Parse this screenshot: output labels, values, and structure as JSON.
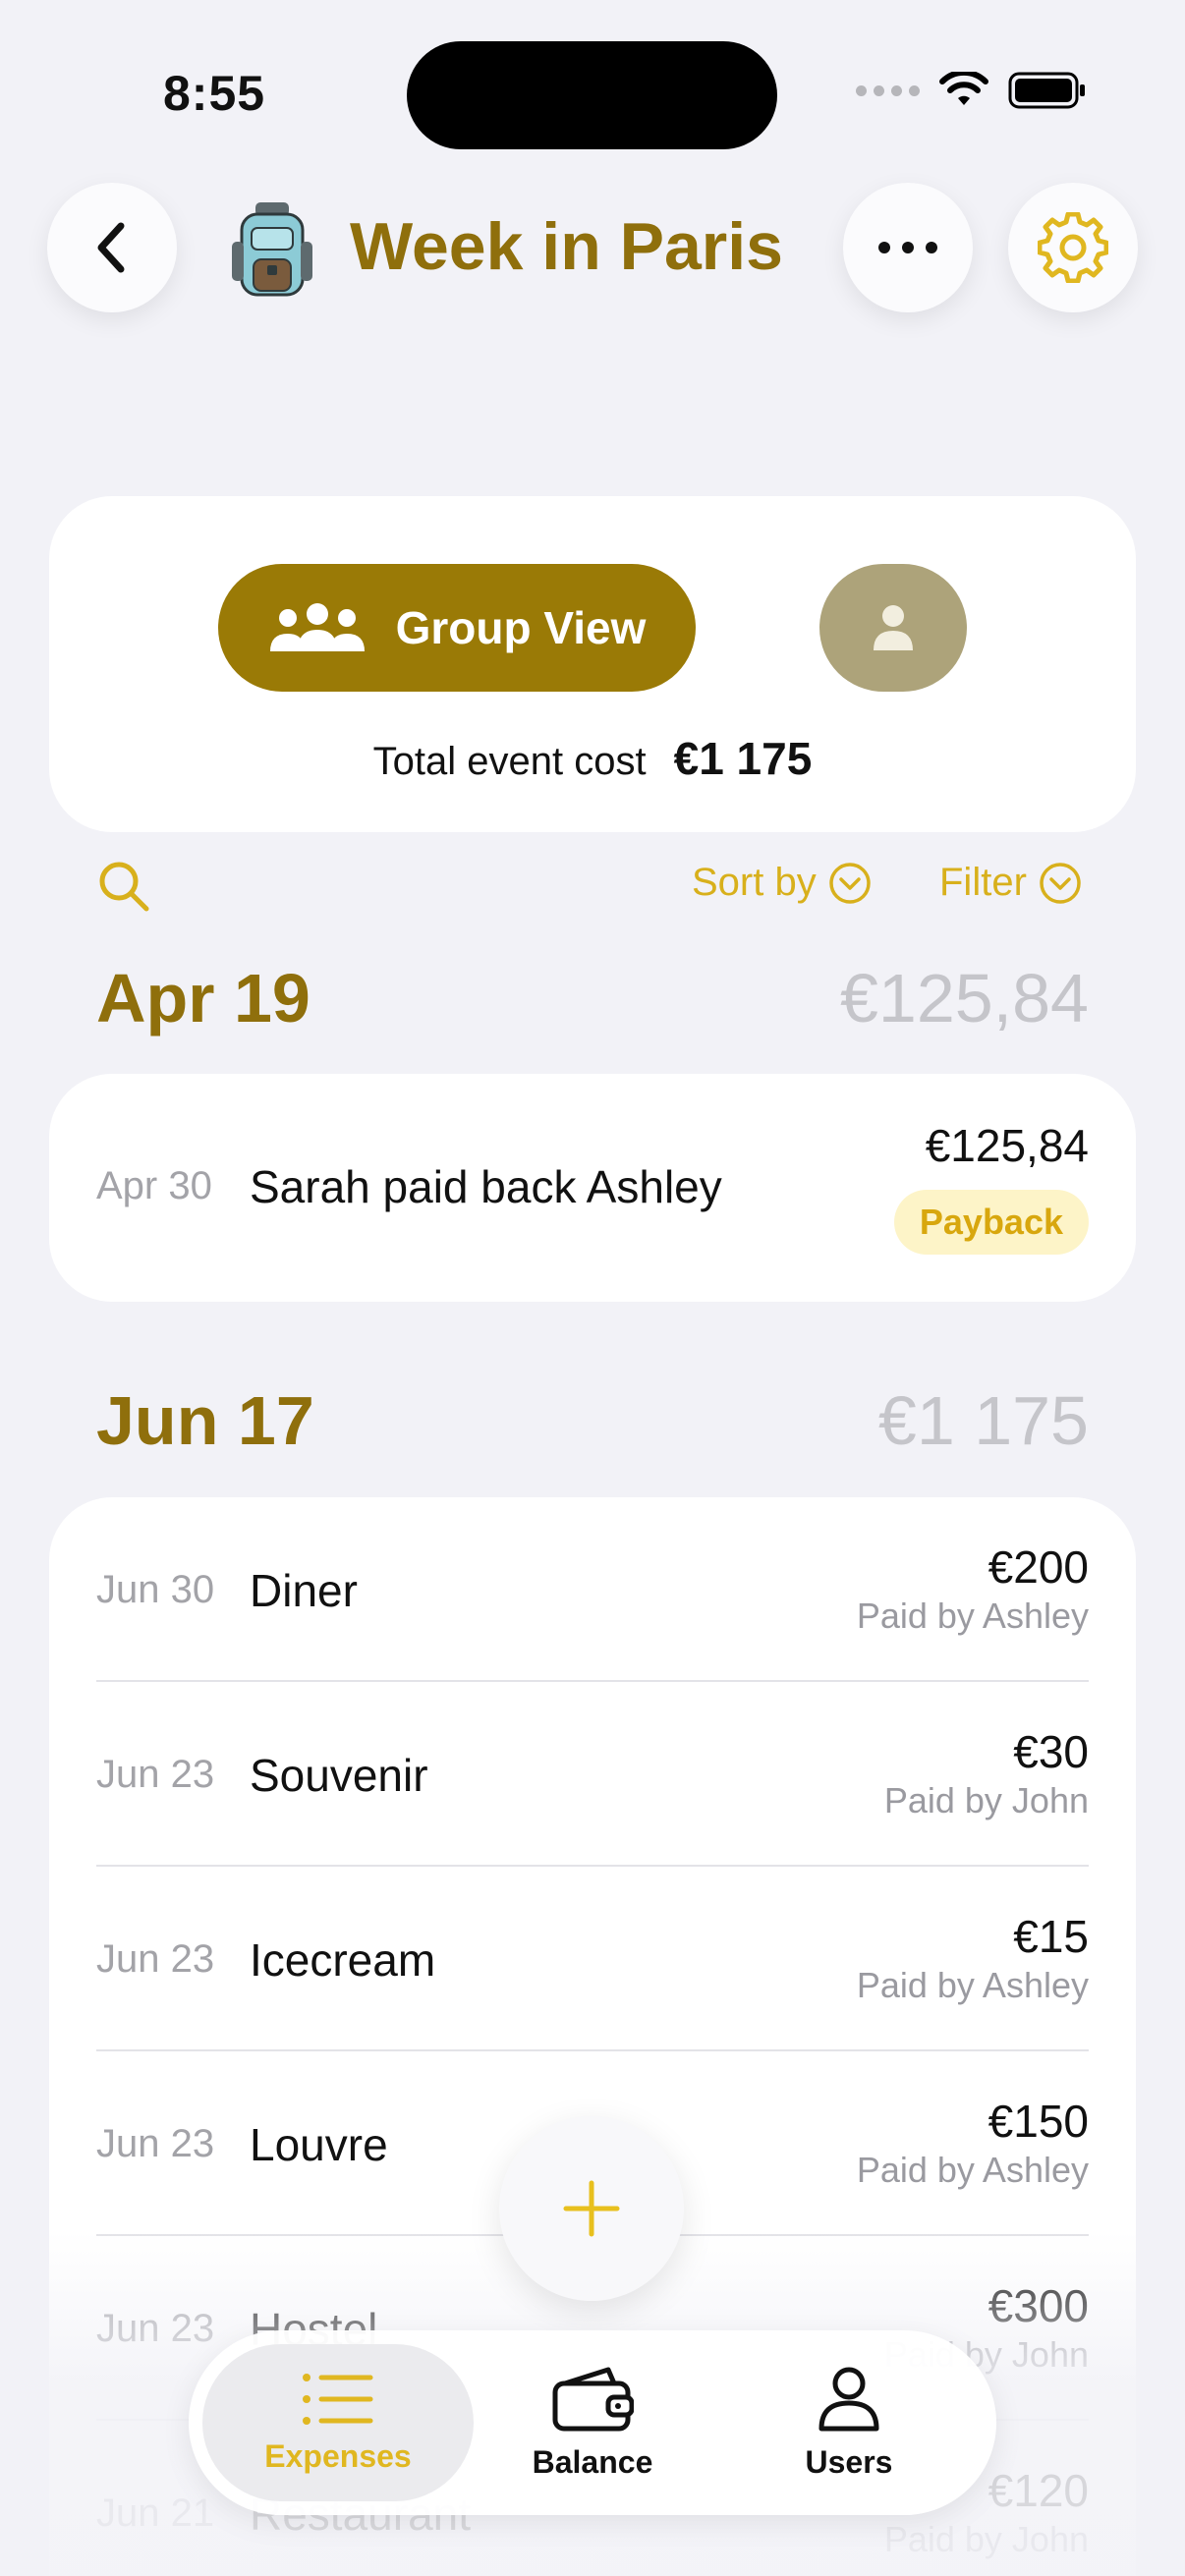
{
  "status_bar": {
    "time": "8:55"
  },
  "header": {
    "title": "Week in Paris",
    "icon": "backpack-icon",
    "back_icon": "chevron-left-icon",
    "more_icon": "ellipsis-icon",
    "settings_icon": "gear-icon"
  },
  "view_switch": {
    "group_label": "Group View",
    "total_label": "Total event cost",
    "total_value": "€1 175"
  },
  "toolbar": {
    "sort_label": "Sort by",
    "filter_label": "Filter"
  },
  "sections": [
    {
      "date": "Apr 19",
      "total": "€125,84",
      "rows": [
        {
          "date": "Apr 30",
          "title": "Sarah paid back Ashley",
          "amount": "€125,84",
          "badge": "Payback"
        }
      ]
    },
    {
      "date": "Jun 17",
      "total": "€1 175",
      "rows": [
        {
          "date": "Jun 30",
          "title": "Diner",
          "amount": "€200",
          "paid_by": "Paid by Ashley"
        },
        {
          "date": "Jun 23",
          "title": "Souvenir",
          "amount": "€30",
          "paid_by": "Paid by John"
        },
        {
          "date": "Jun 23",
          "title": "Icecream",
          "amount": "€15",
          "paid_by": "Paid by Ashley"
        },
        {
          "date": "Jun 23",
          "title": "Louvre",
          "amount": "€150",
          "paid_by": "Paid by Ashley"
        },
        {
          "date": "Jun 23",
          "title": "Hostel",
          "amount": "€300",
          "paid_by": "Paid by John"
        },
        {
          "date": "Jun 21",
          "title": "Restaurant",
          "amount": "€120",
          "paid_by": "Paid by John"
        }
      ]
    }
  ],
  "tab_bar": {
    "tabs": [
      {
        "label": "Expenses",
        "icon": "list-icon",
        "active": true
      },
      {
        "label": "Balance",
        "icon": "wallet-icon",
        "active": false
      },
      {
        "label": "Users",
        "icon": "person-icon",
        "active": false
      }
    ]
  },
  "colors": {
    "brand": "#8f6f0c",
    "accent": "#d8b01c",
    "group_button": "#9a7a06",
    "background": "#f2f2f7"
  }
}
